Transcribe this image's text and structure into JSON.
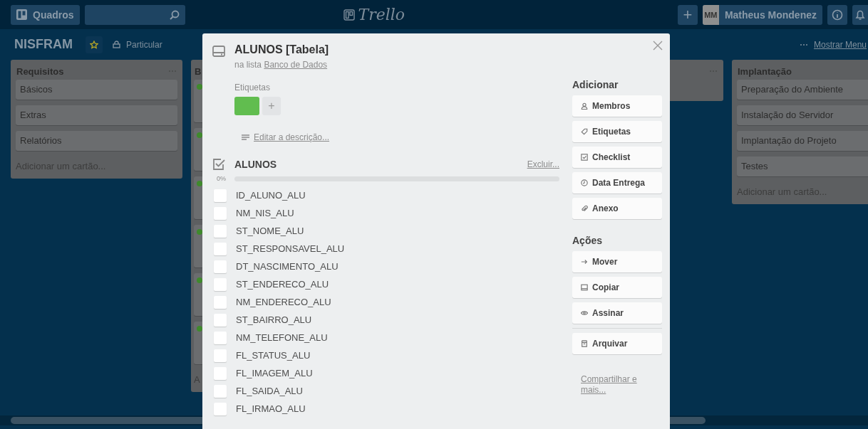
{
  "top_bar": {
    "boards_button": "Quadros",
    "logo": "Trello",
    "add_symbol": "+",
    "user_initials": "MM",
    "user_name": "Matheus Mondenez"
  },
  "board": {
    "title": "NISFRAM",
    "starred": true,
    "visibility": "Particular",
    "menu_link": "Mostrar Menu"
  },
  "lists": [
    {
      "kind": "list",
      "title": "Requisitos",
      "cards": [
        {
          "text": "Básicos"
        },
        {
          "text": "Extras"
        },
        {
          "text": "Relatórios"
        }
      ],
      "add_card": "Adicionar um cartão..."
    },
    {
      "kind": "list",
      "title": "B",
      "cards": [
        {
          "color": "#3f8a2c"
        },
        {
          "color": "#3f8a2c"
        },
        {
          "color": "#3f8a2c"
        },
        {
          "color": "#3f8a2c"
        },
        {
          "color": "#3f8a2c"
        },
        {
          "color": "#3f8a2c"
        }
      ],
      "add_card": "A"
    },
    {
      "kind": "hidden"
    },
    {
      "kind": "list"
    },
    {
      "kind": "list",
      "title": "Implantação",
      "cards": [
        {
          "text": "Preparação do Ambiente"
        },
        {
          "text": "Instalação do Servidor"
        },
        {
          "text": "Implantação do Projeto"
        },
        {
          "text": "Testes"
        }
      ],
      "add_card": "Adicionar um cartão..."
    }
  ],
  "card_modal": {
    "title": "ALUNOS [Tabela]",
    "list_prefix": "na lista",
    "list_name": "Banco de Dados",
    "labels_heading": "Etiquetas",
    "labels": [
      {
        "color": "#61bd4f"
      }
    ],
    "add_label": "+",
    "description_link": "Editar a descrição...",
    "checklist": {
      "title": "ALUNOS",
      "delete_link": "Excluir...",
      "percent": "0%",
      "level": 0,
      "items": [
        {
          "text": "ID_ALUNO_ALU",
          "checked": false
        },
        {
          "text": "NM_NIS_ALU",
          "checked": false
        },
        {
          "text": "ST_NOME_ALU",
          "checked": false
        },
        {
          "text": "ST_RESPONSAVEL_ALU",
          "checked": false
        },
        {
          "text": "DT_NASCIMENTO_ALU",
          "checked": false
        },
        {
          "text": "ST_ENDERECO_ALU",
          "checked": false
        },
        {
          "text": "NM_ENDERECO_ALU",
          "checked": false
        },
        {
          "text": "ST_BAIRRO_ALU",
          "checked": false
        },
        {
          "text": "NM_TELEFONE_ALU",
          "checked": false
        },
        {
          "text": "FL_STATUS_ALU",
          "checked": false
        },
        {
          "text": "FL_IMAGEM_ALU",
          "checked": false
        },
        {
          "text": "FL_SAIDA_ALU",
          "checked": false
        },
        {
          "text": "FL_IRMAO_ALU",
          "checked": false
        }
      ]
    },
    "add_heading": "Adicionar",
    "add_buttons": [
      {
        "label": "Membros",
        "kind": "person"
      },
      {
        "label": "Etiquetas",
        "kind": "tag"
      },
      {
        "label": "Checklist",
        "kind": "checklist"
      },
      {
        "label": "Data Entrega",
        "kind": "clock"
      },
      {
        "label": "Anexo",
        "kind": "clip"
      }
    ],
    "actions_heading": "Ações",
    "action_buttons": [
      {
        "label": "Mover",
        "kind": "arrow"
      },
      {
        "label": "Copiar",
        "kind": "card"
      },
      {
        "label": "Assinar",
        "kind": "eye"
      },
      {
        "label": "Arquivar",
        "kind": "archive"
      }
    ],
    "share_link": "Compartilhar e mais..."
  }
}
